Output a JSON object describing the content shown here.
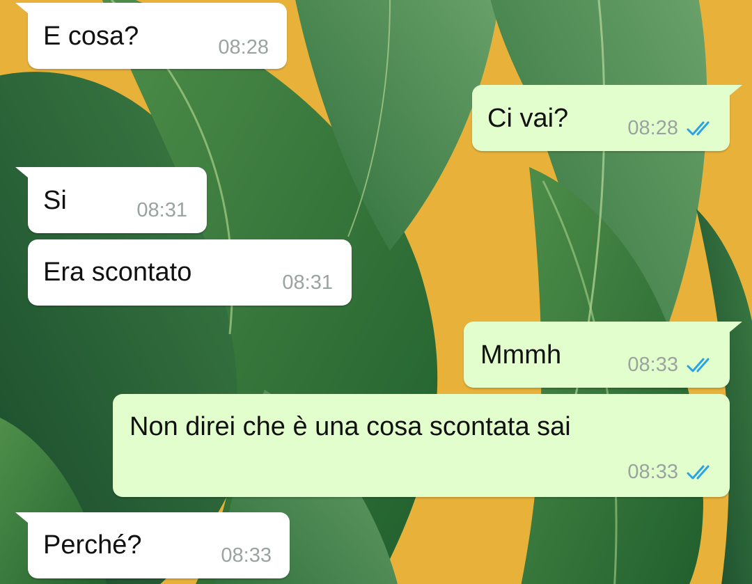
{
  "colors": {
    "wallpaper_base": "#e8b23a",
    "incoming_bubble": "#ffffff",
    "outgoing_bubble": "#e2fecd",
    "timestamp": "#9aa3a0",
    "read_ticks": "#2aa3e6"
  },
  "messages": [
    {
      "direction": "incoming",
      "text": "E cosa?",
      "time": "08:28"
    },
    {
      "direction": "outgoing",
      "text": "Ci vai?",
      "time": "08:28",
      "status_icon": "double-check-read-icon"
    },
    {
      "direction": "incoming",
      "text": "Si",
      "time": "08:31"
    },
    {
      "direction": "incoming",
      "text": "Era scontato",
      "time": "08:31"
    },
    {
      "direction": "outgoing",
      "text": "Mmmh",
      "time": "08:33",
      "status_icon": "double-check-read-icon"
    },
    {
      "direction": "outgoing",
      "text": "Non direi che è una cosa scontata sai",
      "time": "08:33",
      "status_icon": "double-check-read-icon"
    },
    {
      "direction": "incoming",
      "text": "Perché?",
      "time": "08:33"
    }
  ]
}
